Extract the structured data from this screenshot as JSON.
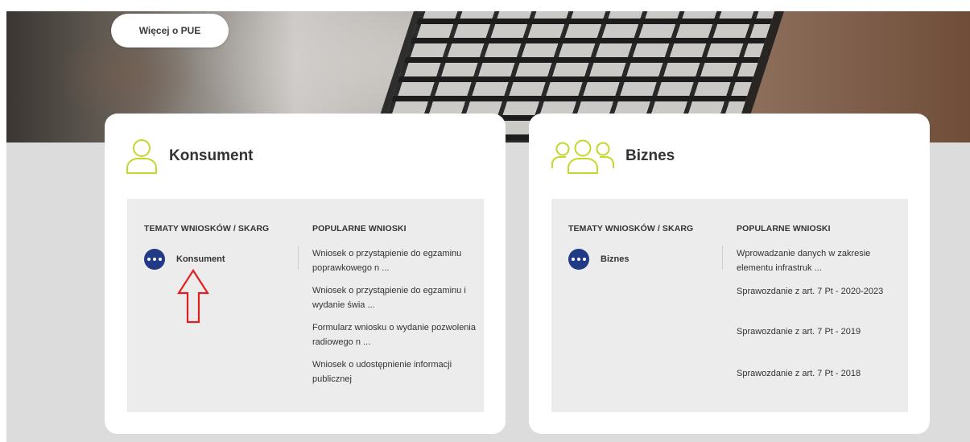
{
  "hero": {
    "more_button": "Więcej o PUE"
  },
  "consumer": {
    "title": "Konsument",
    "topics_heading": "TEMATY WNIOSKÓW / SKARG",
    "popular_heading": "POPULARNE WNIOSKI",
    "topic_label": "Konsument",
    "popular": [
      "Wniosek o przystąpienie do egzaminu poprawkowego n ...",
      "Wniosek o przystąpienie do egzaminu i wydanie świa ...",
      "Formularz wniosku o wydanie pozwolenia radiowego n ...",
      "Wniosek o udostępnienie informacji publicznej"
    ]
  },
  "business": {
    "title": "Biznes",
    "topics_heading": "TEMATY WNIOSKÓW / SKARG",
    "popular_heading": "POPULARNE WNIOSKI",
    "topic_label": "Biznes",
    "popular": [
      "Wprowadzanie danych w zakresie elementu infrastruk ...",
      "Sprawozdanie z art. 7 Pt - 2020-2023",
      "Sprawozdanie z art. 7 Pt - 2019",
      "Sprawozdanie z art. 7 Pt - 2018"
    ]
  },
  "colors": {
    "accent_green": "#c5d72a",
    "navy": "#203a85",
    "annotation_red": "#e02020",
    "panel_gray": "#ececec",
    "page_gray": "#dcdcdc"
  },
  "icons": {
    "person": "person-outline-icon",
    "group": "people-group-icon",
    "more": "more-dots-icon",
    "annotation": "red-arrow-up-icon"
  }
}
